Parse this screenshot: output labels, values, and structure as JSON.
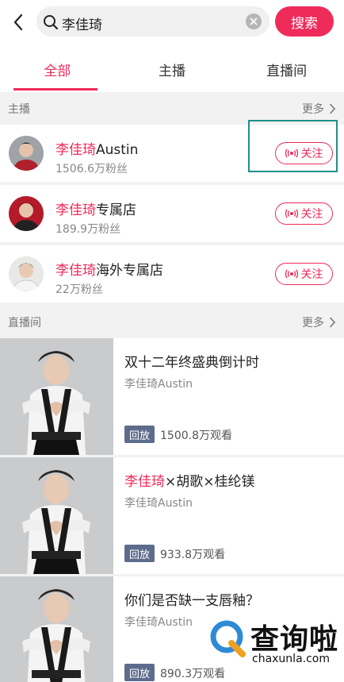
{
  "search": {
    "query": "李佳琦",
    "button_label": "搜索"
  },
  "tabs": [
    {
      "label": "全部",
      "active": true
    },
    {
      "label": "主播",
      "active": false
    },
    {
      "label": "直播间",
      "active": false
    }
  ],
  "anchors_section": {
    "title": "主播",
    "more_label": "更多"
  },
  "anchors": [
    {
      "name_highlight": "李佳琦",
      "name_rest": "Austin",
      "fans": "1506.6万粉丝",
      "follow_label": "关注"
    },
    {
      "name_highlight": "李佳琦",
      "name_rest": "专属店",
      "fans": "189.9万粉丝",
      "follow_label": "关注"
    },
    {
      "name_highlight": "李佳琦",
      "name_rest": "海外专属店",
      "fans": "22万粉丝",
      "follow_label": "关注"
    }
  ],
  "live_section": {
    "title": "直播间",
    "more_label": "更多"
  },
  "live_rooms": [
    {
      "title_highlight": "",
      "title_rest": "双十二年终盛典倒计时",
      "author": "李佳琦Austin",
      "badge": "回放",
      "views": "1500.8万观看"
    },
    {
      "title_highlight": "李佳琦",
      "title_rest": "×胡歌×桂纶镁",
      "author": "李佳琦Austin",
      "badge": "回放",
      "views": "933.8万观看"
    },
    {
      "title_highlight": "",
      "title_rest": "你们是否缺一支唇釉？",
      "author": "李佳琦Austin",
      "badge": "回放",
      "views": "890.3万观看"
    }
  ],
  "watermark": {
    "brand": "查询啦",
    "url": "chaxunla.com"
  },
  "colors": {
    "accent": "#ef2b5a",
    "badge": "#5d6c8c",
    "highlight_frame": "#1f8f8a"
  }
}
